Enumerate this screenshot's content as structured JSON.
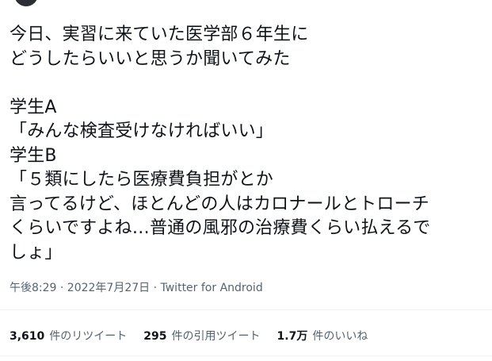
{
  "tweet": {
    "lines": [
      "今日、実習に来ていた医学部６年生に",
      "どうしたらいいと思うか聞いてみた",
      "",
      "学生A",
      "「みんな検査受けなければいい」",
      "学生B",
      "「５類にしたら医療費負担がとか",
      "言ってるけど、ほとんどの人はカロナールとトローチ",
      "くらいですよね…普通の風邪の治療費くらい払えるで",
      "しょ」"
    ],
    "timestamp": "午後8:29 · 2022年7月27日",
    "separator": " · ",
    "source": "Twitter for Android"
  },
  "stats": {
    "retweets": {
      "count": "3,610",
      "label": "件のリツイート"
    },
    "quotes": {
      "count": "295",
      "label": "件の引用ツイート"
    },
    "likes": {
      "count": "1.7万",
      "label": "件のいいね"
    }
  },
  "colors": {
    "text": "#0f1419",
    "secondary": "#536471",
    "divider": "#eff3f4"
  }
}
